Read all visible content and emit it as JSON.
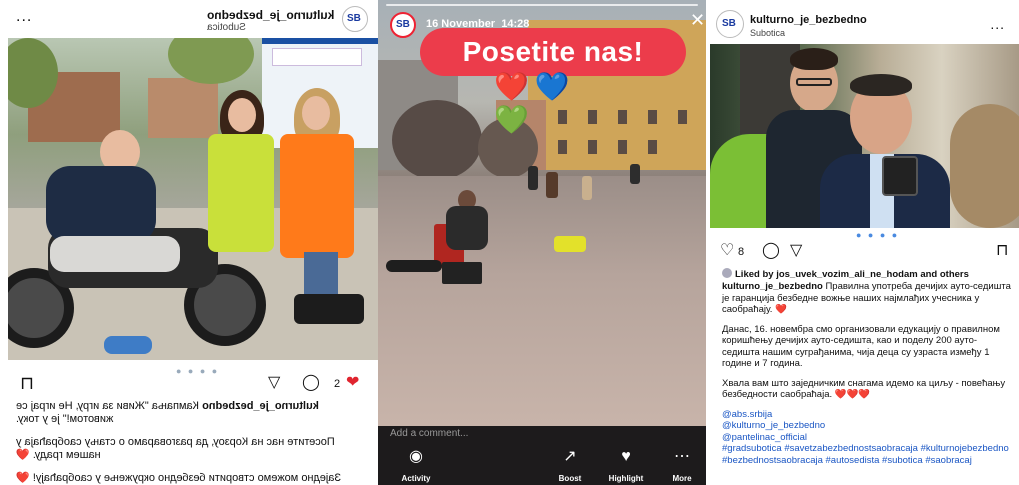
{
  "panel1": {
    "username": "kulturno_je_bezbedno",
    "location": "Subotica",
    "more_glyph": "...",
    "pager": "● ● ● ●",
    "likes_count": "2",
    "caption": [
      {
        "user": "kulturno_je_bezbedno",
        "text": "Кампања \"Живи за игру, Не играј се животом!\" је у току."
      },
      {
        "user": "",
        "text": "Посетите нас на Корзоу, да разговарамо о стању саобраћаја у нашем граду. ❤️"
      },
      {
        "user": "",
        "text": "Заједно можемо створити безбедно окружење у саобраћају! ❤️"
      }
    ]
  },
  "panel2": {
    "date": "16 November",
    "time": "14:28",
    "sticker": "Posetite nas!",
    "hearts": [
      "❤️",
      "💙",
      "💚"
    ],
    "reply_placeholder": "Add a comment...",
    "nav": [
      {
        "label": "Activity",
        "icon": "activity-icon",
        "glyph": "◉"
      },
      {
        "label": "Boost",
        "icon": "boost-icon",
        "glyph": "↗"
      },
      {
        "label": "Highlight",
        "icon": "highlight-icon",
        "glyph": "♥"
      },
      {
        "label": "More",
        "icon": "more-icon",
        "glyph": "⋯"
      }
    ]
  },
  "panel3": {
    "username": "kulturno_je_bezbedno",
    "location": "Subotica",
    "more_glyph": "...",
    "pager": "● ● ● ●",
    "likes_count": "8",
    "liked_by_prefix": "Liked by ",
    "liked_by_user": "jos_uvek_vozim_ali_ne_hodam",
    "liked_by_suffix": " and others",
    "caption_user": "kulturno_je_bezbedno",
    "caption_text": "Правилна употреба дечијих ауто-седишта је гаранција безбедне вожње наших најмлађих учесника у саобраћају. ❤️",
    "paragraph2": "Данас, 16. новембра смо организовали едукацију о правилном коришћењу дечијих ауто-седишта, као и поделу 200 ауто-седишта нашим суграђанима, чија деца су узраста између 1 године и 7 година.",
    "paragraph3": "Хвала вам што заједничким снагама идемо ка циљу - повећању безбедности саобраћаја. ❤️❤️❤️",
    "mentions": [
      "@abs.srbija",
      "@kulturno_je_bezbedno",
      "@pantelinac_official"
    ],
    "hashtags": "#gradsubotica #savetzabezbednostsaobracaja #kulturnojebezbedno #bezbednostsaobracaja #autosedista #subotica #saobracaj"
  },
  "colors": {
    "heart": "#e0242f",
    "link": "#1a56c4",
    "sticker_bg": "#ec3c4b"
  }
}
